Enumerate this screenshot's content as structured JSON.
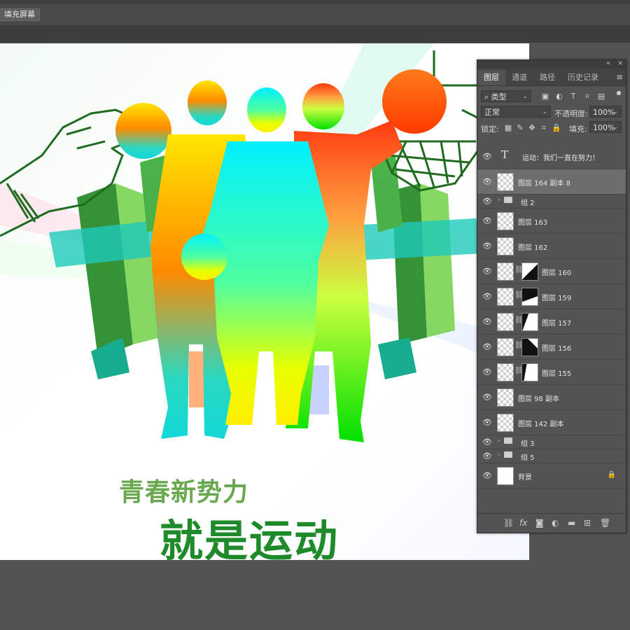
{
  "options_bar": {
    "fill_screen_label": "填充屏幕"
  },
  "canvas": {
    "slogan_line1": "青春新势力",
    "slogan_line2": "就是运动"
  },
  "layers_panel": {
    "tabs": [
      "图层",
      "通道",
      "路径",
      "历史记录"
    ],
    "active_tab": "图层",
    "filter_kind": "类型",
    "blend_mode": "正常",
    "opacity_label": "不透明度:",
    "opacity_value": "100%",
    "lock_label": "锁定:",
    "fill_label": "填充:",
    "fill_value": "100%",
    "layers": [
      {
        "name": "运动：我们一直在努力！",
        "kind": "text"
      },
      {
        "name": "图层 164 副本 8",
        "kind": "pixel",
        "selected": true
      },
      {
        "name": "组 2",
        "kind": "group"
      },
      {
        "name": "图层 163",
        "kind": "pixel"
      },
      {
        "name": "图层 162",
        "kind": "pixel"
      },
      {
        "name": "图层 160",
        "kind": "masked"
      },
      {
        "name": "图层 159",
        "kind": "masked"
      },
      {
        "name": "图层 157",
        "kind": "masked"
      },
      {
        "name": "图层 156",
        "kind": "masked"
      },
      {
        "name": "图层 155",
        "kind": "masked"
      },
      {
        "name": "图层 98 副本",
        "kind": "pixel"
      },
      {
        "name": "图层 142 副本",
        "kind": "pixel"
      },
      {
        "name": "组 3",
        "kind": "group"
      },
      {
        "name": "组 5",
        "kind": "group"
      },
      {
        "name": "背景",
        "kind": "background"
      }
    ]
  }
}
